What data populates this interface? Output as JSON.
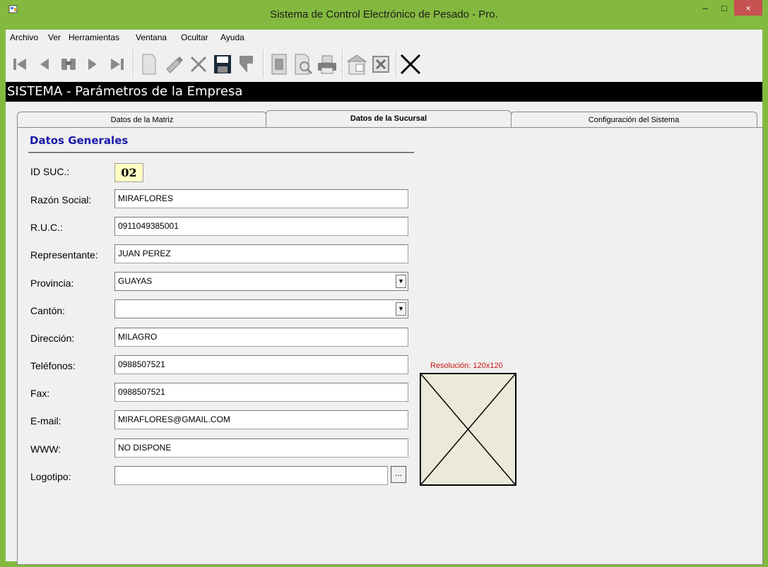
{
  "window": {
    "title": "Sistema de Control Electrónico de Pesado - Pro.",
    "minimize": "–",
    "maximize": "□",
    "close": "×"
  },
  "menu": {
    "items": [
      "Archivo",
      "Ver",
      "Herramientas",
      "Ventana",
      "Ocultar",
      "Ayuda"
    ]
  },
  "toolbar": {
    "icons": [
      "first-record-icon",
      "previous-record-icon",
      "search-binoculars-icon",
      "next-record-icon",
      "last-record-icon",
      "new-document-icon",
      "edit-icon",
      "delete-icon",
      "save-icon",
      "undo-icon",
      "report-icon",
      "preview-icon",
      "print-icon",
      "export-icon",
      "excel-icon",
      "close-icon"
    ]
  },
  "section": {
    "title": "SISTEMA - Parámetros de la Empresa"
  },
  "tabs": [
    {
      "label": "Datos de la Matriz",
      "active": false
    },
    {
      "label": "Datos de la Sucursal",
      "active": true
    },
    {
      "label": "Configuración del Sistema",
      "active": false
    }
  ],
  "form": {
    "group_title": "Datos Generales",
    "id_label": "ID SUC.:",
    "id_value": "02",
    "razon_label": "Razón Social:",
    "razon_value": "MIRAFLORES",
    "ruc_label": "R.U.C.:",
    "ruc_value": "0911049385001",
    "representante_label": "Representante:",
    "representante_value": "JUAN PEREZ",
    "provincia_label": "Provincia:",
    "provincia_value": "GUAYAS",
    "canton_label": "Cantón:",
    "canton_value": "",
    "direccion_label": "Dirección:",
    "direccion_value": "MILAGRO",
    "telefonos_label": "Teléfonos:",
    "telefonos_value": "0988507521",
    "fax_label": "Fax:",
    "fax_value": "0988507521",
    "email_label": "E-mail:",
    "email_value": "MIRAFLORES@GMAIL.COM",
    "www_label": "WWW:",
    "www_value": "NO DISPONE",
    "logotipo_label": "Logotipo:",
    "logotipo_value": "",
    "browse_label": "...",
    "resolution_label": "Resolución: 120x120"
  },
  "colors": {
    "frame": "#84b93f",
    "group_title": "#1a1aa8",
    "resolution": "#cc1212",
    "id_background": "#ffffc4",
    "close_button": "#c75050"
  }
}
